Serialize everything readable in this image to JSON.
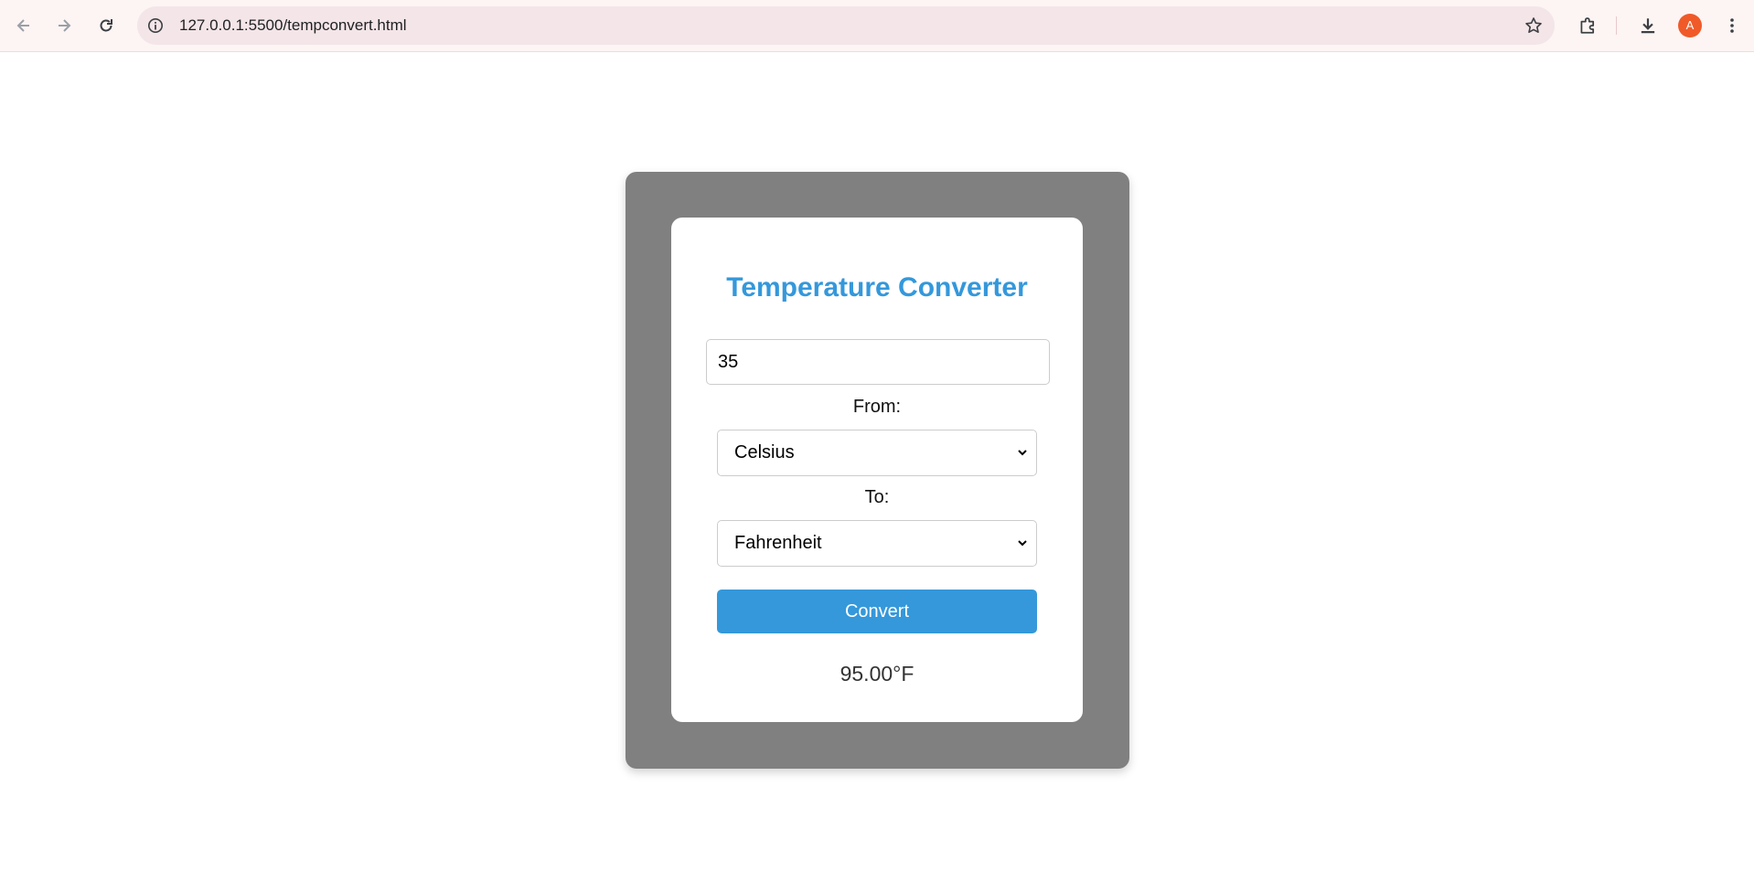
{
  "browser": {
    "url": "127.0.0.1:5500/tempconvert.html",
    "avatar_letter": "A",
    "icons": [
      "back-icon",
      "forward-icon",
      "reload-icon",
      "info-icon",
      "star-icon",
      "extensions-icon",
      "download-icon",
      "menu-icon"
    ]
  },
  "converter": {
    "title": "Temperature Converter",
    "input_value": "35",
    "from_label": "From:",
    "from_selected": "Celsius",
    "to_label": "To:",
    "to_selected": "Fahrenheit",
    "convert_label": "Convert",
    "result": "95.00°F"
  },
  "colors": {
    "accent": "#3498db",
    "frame": "#808080",
    "avatar": "#f05a28"
  }
}
